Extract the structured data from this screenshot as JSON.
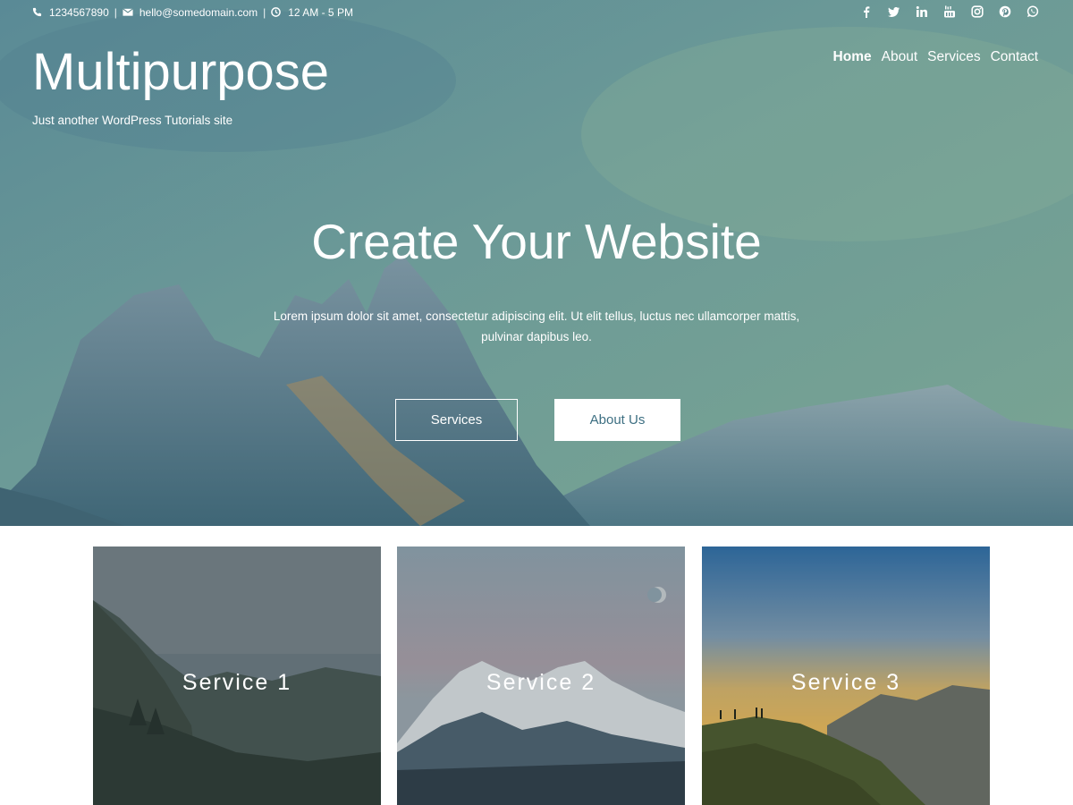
{
  "topbar": {
    "phone": "1234567890",
    "email": "hello@somedomain.com",
    "hours": "12 AM - 5 PM",
    "separator": "|"
  },
  "social_icons": [
    "facebook-icon",
    "twitter-icon",
    "linkedin-icon",
    "youtube-icon",
    "instagram-icon",
    "pinterest-icon",
    "whatsapp-icon"
  ],
  "site": {
    "title": "Multipurpose",
    "tagline": "Just another WordPress Tutorials site"
  },
  "nav": {
    "items": [
      {
        "label": "Home",
        "active": true
      },
      {
        "label": "About",
        "active": false
      },
      {
        "label": "Services",
        "active": false
      },
      {
        "label": "Contact",
        "active": false
      }
    ]
  },
  "hero": {
    "title": "Create Your Website",
    "text": "Lorem ipsum dolor sit amet, consectetur adipiscing elit. Ut elit tellus, luctus nec ullamcorper mattis, pulvinar dapibus leo.",
    "button_primary": "Services",
    "button_secondary": "About Us"
  },
  "services": [
    {
      "label": "Service 1"
    },
    {
      "label": "Service 2"
    },
    {
      "label": "Service 3"
    }
  ],
  "colors": {
    "accent_text": "#3d6f82",
    "hero_tint": "#5e8a8f",
    "white": "#ffffff"
  }
}
